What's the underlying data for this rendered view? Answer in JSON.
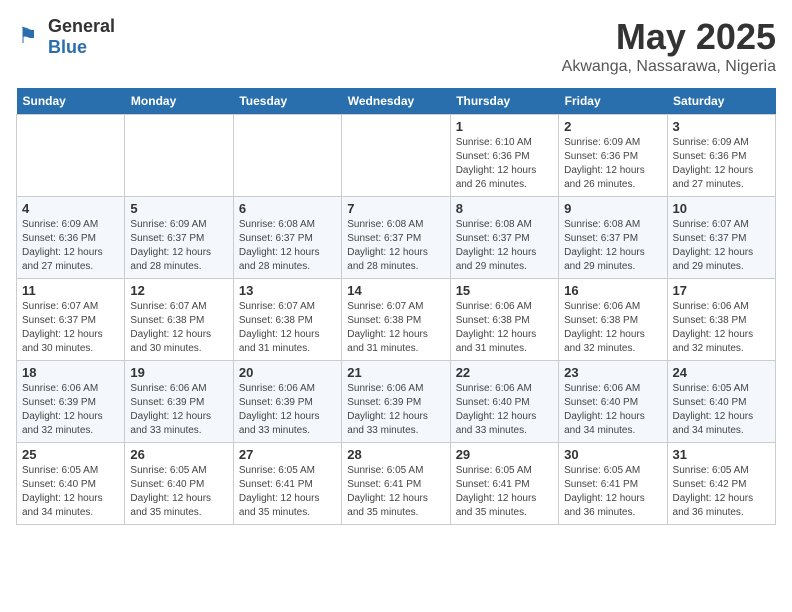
{
  "header": {
    "logo_general": "General",
    "logo_blue": "Blue",
    "month_year": "May 2025",
    "location": "Akwanga, Nassarawa, Nigeria"
  },
  "weekdays": [
    "Sunday",
    "Monday",
    "Tuesday",
    "Wednesday",
    "Thursday",
    "Friday",
    "Saturday"
  ],
  "weeks": [
    [
      {
        "day": "",
        "sunrise": "",
        "sunset": "",
        "daylight": ""
      },
      {
        "day": "",
        "sunrise": "",
        "sunset": "",
        "daylight": ""
      },
      {
        "day": "",
        "sunrise": "",
        "sunset": "",
        "daylight": ""
      },
      {
        "day": "",
        "sunrise": "",
        "sunset": "",
        "daylight": ""
      },
      {
        "day": "1",
        "sunrise": "Sunrise: 6:10 AM",
        "sunset": "Sunset: 6:36 PM",
        "daylight": "Daylight: 12 hours and 26 minutes."
      },
      {
        "day": "2",
        "sunrise": "Sunrise: 6:09 AM",
        "sunset": "Sunset: 6:36 PM",
        "daylight": "Daylight: 12 hours and 26 minutes."
      },
      {
        "day": "3",
        "sunrise": "Sunrise: 6:09 AM",
        "sunset": "Sunset: 6:36 PM",
        "daylight": "Daylight: 12 hours and 27 minutes."
      }
    ],
    [
      {
        "day": "4",
        "sunrise": "Sunrise: 6:09 AM",
        "sunset": "Sunset: 6:36 PM",
        "daylight": "Daylight: 12 hours and 27 minutes."
      },
      {
        "day": "5",
        "sunrise": "Sunrise: 6:09 AM",
        "sunset": "Sunset: 6:37 PM",
        "daylight": "Daylight: 12 hours and 28 minutes."
      },
      {
        "day": "6",
        "sunrise": "Sunrise: 6:08 AM",
        "sunset": "Sunset: 6:37 PM",
        "daylight": "Daylight: 12 hours and 28 minutes."
      },
      {
        "day": "7",
        "sunrise": "Sunrise: 6:08 AM",
        "sunset": "Sunset: 6:37 PM",
        "daylight": "Daylight: 12 hours and 28 minutes."
      },
      {
        "day": "8",
        "sunrise": "Sunrise: 6:08 AM",
        "sunset": "Sunset: 6:37 PM",
        "daylight": "Daylight: 12 hours and 29 minutes."
      },
      {
        "day": "9",
        "sunrise": "Sunrise: 6:08 AM",
        "sunset": "Sunset: 6:37 PM",
        "daylight": "Daylight: 12 hours and 29 minutes."
      },
      {
        "day": "10",
        "sunrise": "Sunrise: 6:07 AM",
        "sunset": "Sunset: 6:37 PM",
        "daylight": "Daylight: 12 hours and 29 minutes."
      }
    ],
    [
      {
        "day": "11",
        "sunrise": "Sunrise: 6:07 AM",
        "sunset": "Sunset: 6:37 PM",
        "daylight": "Daylight: 12 hours and 30 minutes."
      },
      {
        "day": "12",
        "sunrise": "Sunrise: 6:07 AM",
        "sunset": "Sunset: 6:38 PM",
        "daylight": "Daylight: 12 hours and 30 minutes."
      },
      {
        "day": "13",
        "sunrise": "Sunrise: 6:07 AM",
        "sunset": "Sunset: 6:38 PM",
        "daylight": "Daylight: 12 hours and 31 minutes."
      },
      {
        "day": "14",
        "sunrise": "Sunrise: 6:07 AM",
        "sunset": "Sunset: 6:38 PM",
        "daylight": "Daylight: 12 hours and 31 minutes."
      },
      {
        "day": "15",
        "sunrise": "Sunrise: 6:06 AM",
        "sunset": "Sunset: 6:38 PM",
        "daylight": "Daylight: 12 hours and 31 minutes."
      },
      {
        "day": "16",
        "sunrise": "Sunrise: 6:06 AM",
        "sunset": "Sunset: 6:38 PM",
        "daylight": "Daylight: 12 hours and 32 minutes."
      },
      {
        "day": "17",
        "sunrise": "Sunrise: 6:06 AM",
        "sunset": "Sunset: 6:38 PM",
        "daylight": "Daylight: 12 hours and 32 minutes."
      }
    ],
    [
      {
        "day": "18",
        "sunrise": "Sunrise: 6:06 AM",
        "sunset": "Sunset: 6:39 PM",
        "daylight": "Daylight: 12 hours and 32 minutes."
      },
      {
        "day": "19",
        "sunrise": "Sunrise: 6:06 AM",
        "sunset": "Sunset: 6:39 PM",
        "daylight": "Daylight: 12 hours and 33 minutes."
      },
      {
        "day": "20",
        "sunrise": "Sunrise: 6:06 AM",
        "sunset": "Sunset: 6:39 PM",
        "daylight": "Daylight: 12 hours and 33 minutes."
      },
      {
        "day": "21",
        "sunrise": "Sunrise: 6:06 AM",
        "sunset": "Sunset: 6:39 PM",
        "daylight": "Daylight: 12 hours and 33 minutes."
      },
      {
        "day": "22",
        "sunrise": "Sunrise: 6:06 AM",
        "sunset": "Sunset: 6:40 PM",
        "daylight": "Daylight: 12 hours and 33 minutes."
      },
      {
        "day": "23",
        "sunrise": "Sunrise: 6:06 AM",
        "sunset": "Sunset: 6:40 PM",
        "daylight": "Daylight: 12 hours and 34 minutes."
      },
      {
        "day": "24",
        "sunrise": "Sunrise: 6:05 AM",
        "sunset": "Sunset: 6:40 PM",
        "daylight": "Daylight: 12 hours and 34 minutes."
      }
    ],
    [
      {
        "day": "25",
        "sunrise": "Sunrise: 6:05 AM",
        "sunset": "Sunset: 6:40 PM",
        "daylight": "Daylight: 12 hours and 34 minutes."
      },
      {
        "day": "26",
        "sunrise": "Sunrise: 6:05 AM",
        "sunset": "Sunset: 6:40 PM",
        "daylight": "Daylight: 12 hours and 35 minutes."
      },
      {
        "day": "27",
        "sunrise": "Sunrise: 6:05 AM",
        "sunset": "Sunset: 6:41 PM",
        "daylight": "Daylight: 12 hours and 35 minutes."
      },
      {
        "day": "28",
        "sunrise": "Sunrise: 6:05 AM",
        "sunset": "Sunset: 6:41 PM",
        "daylight": "Daylight: 12 hours and 35 minutes."
      },
      {
        "day": "29",
        "sunrise": "Sunrise: 6:05 AM",
        "sunset": "Sunset: 6:41 PM",
        "daylight": "Daylight: 12 hours and 35 minutes."
      },
      {
        "day": "30",
        "sunrise": "Sunrise: 6:05 AM",
        "sunset": "Sunset: 6:41 PM",
        "daylight": "Daylight: 12 hours and 36 minutes."
      },
      {
        "day": "31",
        "sunrise": "Sunrise: 6:05 AM",
        "sunset": "Sunset: 6:42 PM",
        "daylight": "Daylight: 12 hours and 36 minutes."
      }
    ]
  ]
}
